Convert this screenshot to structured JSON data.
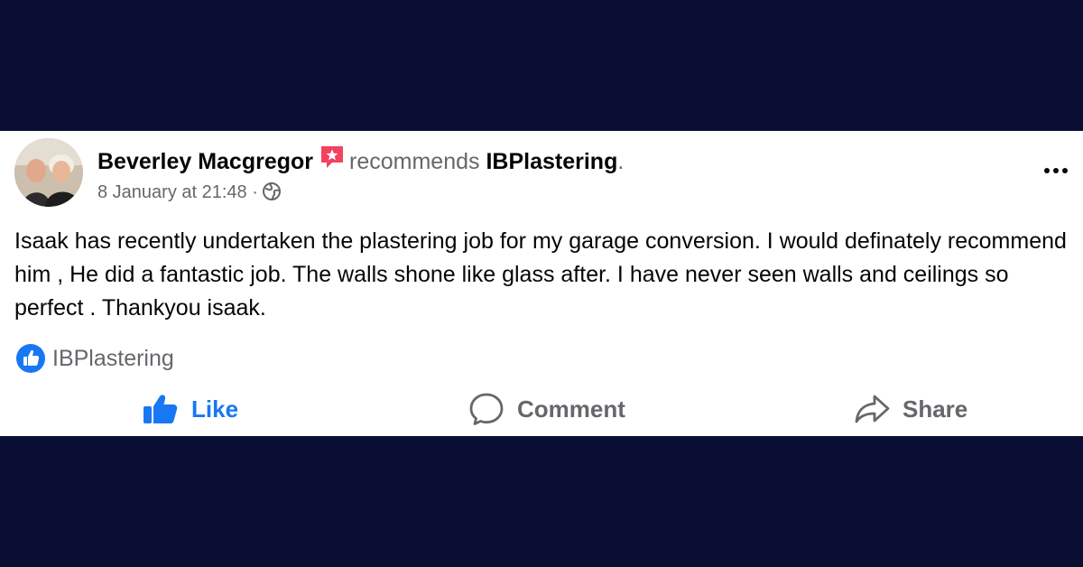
{
  "post": {
    "author": "Beverley Macgregor",
    "recommends_word": "recommends",
    "page_name": "IBPlastering",
    "period": ".",
    "timestamp": "8 January at 21:48",
    "separator": "·",
    "privacy_icon": "globe-icon",
    "body": "Isaak has recently undertaken the plastering job for my garage conversion. I would definately recommend him , He did a fantastic job. The walls shone like glass after. I have never seen walls and ceilings so perfect . Thankyou isaak."
  },
  "reactions": {
    "icon": "like-icon",
    "name": "IBPlastering"
  },
  "actions": {
    "like_label": "Like",
    "comment_label": "Comment",
    "share_label": "Share"
  },
  "colors": {
    "background": "#0a0e33",
    "card": "#ffffff",
    "accent": "#1877f2",
    "muted": "#65676b",
    "recommend_badge": "#f3425f"
  }
}
